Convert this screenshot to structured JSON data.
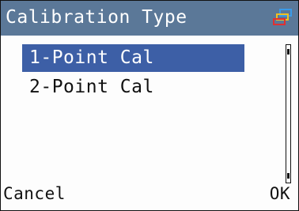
{
  "header": {
    "title": "Calibration Type",
    "icon": "network-icon",
    "colors": {
      "bar": "#5b7898",
      "icon_blue": "#3a9be8",
      "icon_yellow": "#f0c020",
      "icon_red": "#e03030"
    }
  },
  "menu": {
    "items": [
      {
        "label": "1-Point Cal",
        "selected": true
      },
      {
        "label": "2-Point Cal",
        "selected": false
      }
    ],
    "selection_color": "#3d5fa6"
  },
  "softkeys": {
    "left": "Cancel",
    "right": "OK"
  }
}
